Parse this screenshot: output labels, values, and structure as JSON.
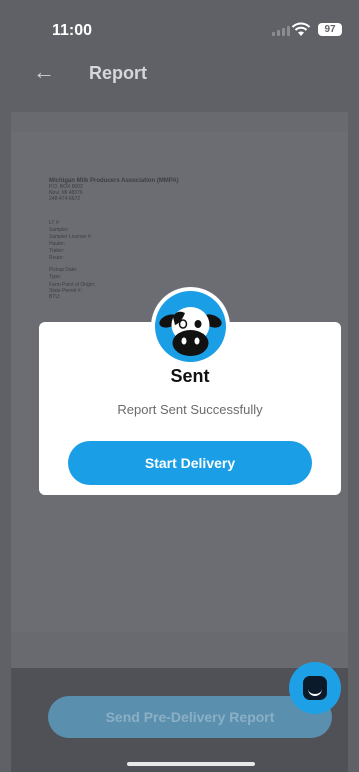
{
  "status": {
    "time": "11:00",
    "battery": "97"
  },
  "header": {
    "back_glyph": "←",
    "title": "Report"
  },
  "document": {
    "lines": [
      "Michigan Milk Producers Association (MMPA)",
      "P.O. BOX 8002",
      "Novi, MI 48376",
      "248-474-6672",
      "LT #:",
      "Sampler:",
      "Sampler License #:",
      "Hauler:",
      "Trailer:",
      "Route:",
      "Pickup Date:",
      "Type:",
      "Farm Point of Origin:",
      "State Permit #:",
      "BTU:"
    ]
  },
  "modal": {
    "title": "Sent",
    "message": "Report Sent Successfully",
    "button": "Start Delivery"
  },
  "footer": {
    "button": "Send Pre-Delivery Report"
  },
  "colors": {
    "accent": "#1a9ee6"
  }
}
